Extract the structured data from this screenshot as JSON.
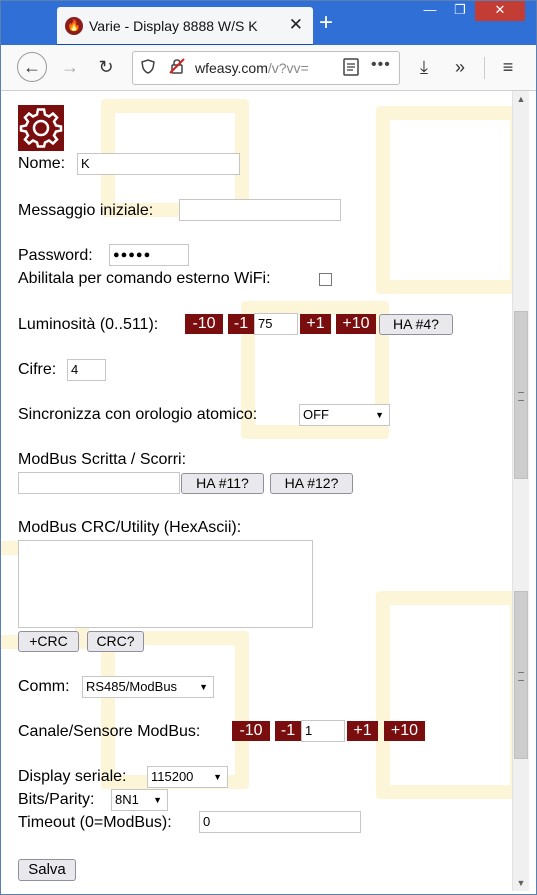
{
  "browser": {
    "tab_title": "Varie - Display 8888 W/S K",
    "tab_close": "✕",
    "new_tab": "+",
    "url_main": "wfeasy.com",
    "url_rest": "/v?vv=",
    "window_controls": {
      "minimize": "—",
      "maximize": "❐",
      "close": "✕"
    },
    "icons": {
      "back": "←",
      "forward": "→",
      "reload": "↻",
      "download": "⤓",
      "overflow": "»",
      "menu": "≡",
      "more": "•••"
    }
  },
  "form": {
    "nome_label": "Nome:",
    "nome_value": "K",
    "messaggio_label": "Messaggio iniziale:",
    "messaggio_value": "",
    "password_label": "Password:",
    "password_value": "●●●●●",
    "wifi_label": "Abilitala per comando esterno WiFi:",
    "wifi_checked": false,
    "luminosita_label": "Luminosità (0..511):",
    "luminosita_minus10": "-10",
    "luminosita_minus1": "-1",
    "luminosita_value": "75",
    "luminosita_plus1": "+1",
    "luminosita_plus10": "+10",
    "luminosita_ha": "HA #4?",
    "cifre_label": "Cifre:",
    "cifre_value": "4",
    "sync_label": "Sincronizza con orologio atomico:",
    "sync_value": "OFF",
    "modbus_scritta_label": "ModBus Scritta / Scorri:",
    "modbus_scritta_value": "",
    "ha11": "HA #11?",
    "ha12": "HA #12?",
    "crc_label": "ModBus CRC/Utility (HexAscii):",
    "crc_value": "",
    "crc_plus_btn": "+CRC",
    "crc_check_btn": "CRC?",
    "comm_label": "Comm:",
    "comm_value": "RS485/ModBus",
    "canale_label": "Canale/Sensore ModBus:",
    "canale_minus10": "-10",
    "canale_minus1": "-1",
    "canale_value": "1",
    "canale_plus1": "+1",
    "canale_plus10": "+10",
    "display_seriale_label": "Display seriale:",
    "display_seriale_value": "115200",
    "bits_label": "Bits/Parity:",
    "bits_value": "8N1",
    "timeout_label": "Timeout (0=ModBus):",
    "timeout_value": "0",
    "salva_btn": "Salva"
  },
  "colors": {
    "accent_red": "#7a0e0e",
    "tab_strip": "#2f6fd6",
    "background_pattern": "#fdf5d8"
  }
}
